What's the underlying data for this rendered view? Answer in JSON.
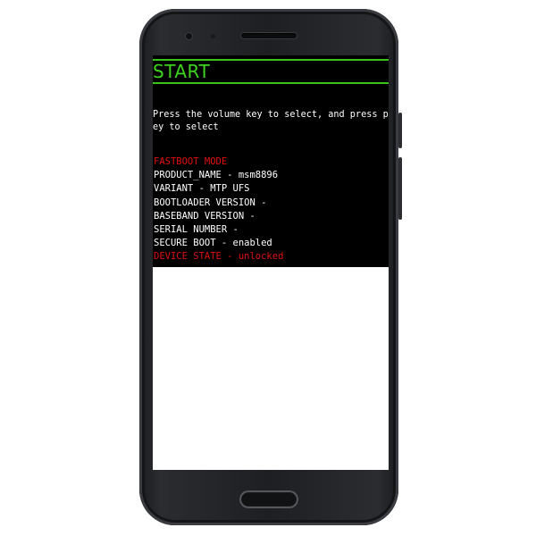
{
  "screen": {
    "title": "START",
    "instructions_line1": "Press the volume key to select, and press power k",
    "instructions_line2": "ey to select",
    "info": [
      {
        "text": "FASTBOOT MODE",
        "color": "#e01010"
      },
      {
        "text": "PRODUCT_NAME - msm8896",
        "color": "#ffffff"
      },
      {
        "text": "VARIANT - MTP UFS",
        "color": "#ffffff"
      },
      {
        "text": "BOOTLOADER VERSION -",
        "color": "#ffffff"
      },
      {
        "text": "BASEBAND VERSION -",
        "color": "#ffffff"
      },
      {
        "text": "SERIAL NUMBER -",
        "color": "#ffffff"
      },
      {
        "text": "SECURE BOOT - enabled",
        "color": "#ffffff"
      },
      {
        "text": "DEVICE STATE - unlocked",
        "color": "#e01010"
      }
    ]
  },
  "colors": {
    "accent_green": "#3ed31f",
    "warning_red": "#e01010",
    "screen_bg": "#000000"
  },
  "icons": {
    "front_camera": "front-camera-icon",
    "earpiece": "earpiece-speaker-icon",
    "home_button": "home-button-icon"
  }
}
